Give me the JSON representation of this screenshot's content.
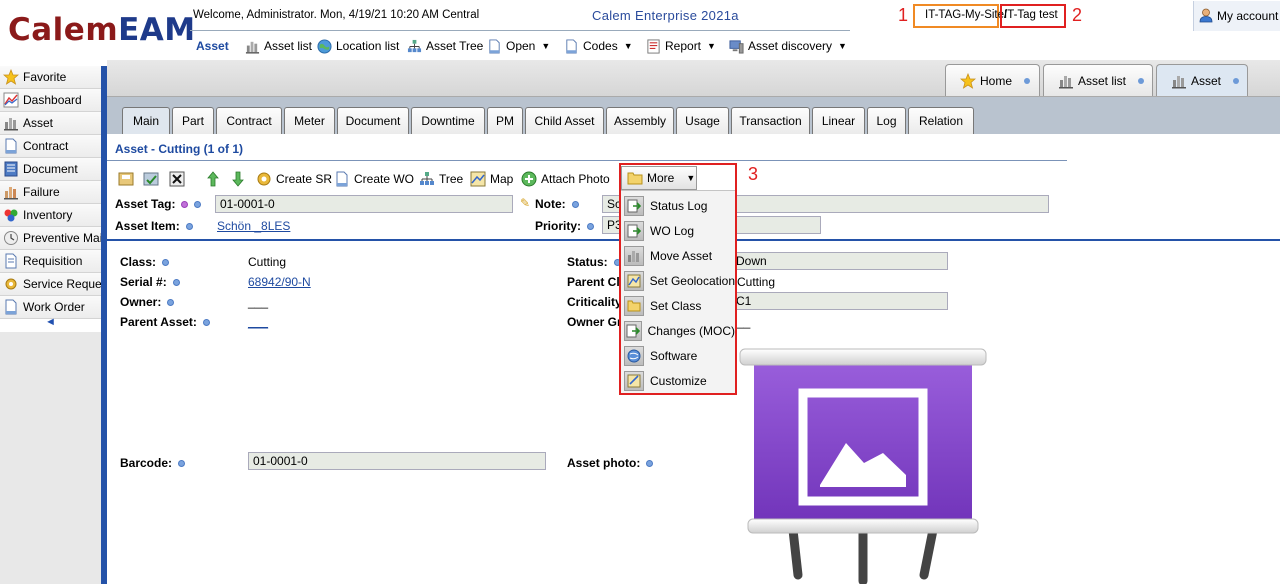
{
  "header": {
    "logo_left": "Calem",
    "logo_right": "EAM",
    "welcome": "Welcome, Administrator. Mon, 4/19/21 10:20 AM Central",
    "product": "Calem Enterprise 2021a",
    "site": "IT-TAG-My-Site/",
    "tag": "IT-Tag test",
    "my_account": "My account"
  },
  "annotations": {
    "n1": "1",
    "n2": "2",
    "n3": "3",
    "color": "#e02020"
  },
  "toolbar": {
    "asset": "Asset",
    "asset_list": "Asset list",
    "location_list": "Location list",
    "asset_tree": "Asset Tree",
    "open": "Open",
    "codes": "Codes",
    "report": "Report",
    "asset_discovery": "Asset discovery"
  },
  "sidebar": {
    "items": [
      {
        "label": "Favorite",
        "icon": "star-icon"
      },
      {
        "label": "Dashboard",
        "icon": "chart-icon"
      },
      {
        "label": "Asset",
        "icon": "asset-icon"
      },
      {
        "label": "Contract",
        "icon": "document-icon"
      },
      {
        "label": "Document",
        "icon": "document-icon"
      },
      {
        "label": "Failure",
        "icon": "failure-icon"
      },
      {
        "label": "Inventory",
        "icon": "inventory-icon"
      },
      {
        "label": "Preventive Maintenance",
        "icon": "clock-icon"
      },
      {
        "label": "Requisition",
        "icon": "requisition-icon"
      },
      {
        "label": "Service Request",
        "icon": "service-icon"
      },
      {
        "label": "Work Order",
        "icon": "document-icon"
      }
    ],
    "collapse": "◄"
  },
  "top_tabs": {
    "home": "Home",
    "asset_list": "Asset list",
    "asset": "Asset"
  },
  "sub_tabs": [
    "Main",
    "Part",
    "Contract",
    "Meter",
    "Document",
    "Downtime",
    "PM",
    "Child Asset",
    "Assembly",
    "Usage",
    "Transaction",
    "Linear",
    "Log",
    "Relation"
  ],
  "form": {
    "heading": "Asset - Cutting (1 of 1)",
    "actions": {
      "create_sr": "Create SR",
      "create_wo": "Create WO",
      "tree": "Tree",
      "map": "Map",
      "attach_photo": "Attach Photo",
      "more": "More"
    },
    "asset_tag_label": "Asset Tag:",
    "asset_tag": "01-0001-0",
    "note_label": "Note:",
    "note": "Sc",
    "asset_item_label": "Asset Item:",
    "asset_item": "Schön _8LES",
    "priority_label": "Priority:",
    "priority": "P3",
    "class_label": "Class:",
    "class": "Cutting",
    "serial_label": "Serial #:",
    "serial": "68942/90-N",
    "owner_label": "Owner:",
    "owner": "___",
    "parent_asset_label": "Parent Asset:",
    "parent_asset": "___",
    "status_label": "Status:",
    "status": "Down",
    "parent_class_label": "Parent Cl",
    "parent_class": "Cutting",
    "criticality_label": "Criticality",
    "criticality": "C1",
    "owner_group_label": "Owner Gr",
    "owner_group": "__",
    "barcode_label": "Barcode:",
    "barcode": "01-0001-0",
    "asset_photo_label": "Asset photo:"
  },
  "more_menu": [
    {
      "label": "Status Log",
      "icon": "status-log-icon"
    },
    {
      "label": "WO Log",
      "icon": "wo-log-icon"
    },
    {
      "label": "Move Asset",
      "icon": "move-asset-icon"
    },
    {
      "label": "Set Geolocation",
      "icon": "geolocation-icon"
    },
    {
      "label": "Set Class",
      "icon": "folder-icon"
    },
    {
      "label": "Changes (MOC)",
      "icon": "changes-icon"
    },
    {
      "label": "Software",
      "icon": "software-icon"
    },
    {
      "label": "Customize",
      "icon": "customize-icon"
    }
  ],
  "colors": {
    "accent": "#2452a8",
    "logo_red": "#8b1a1a",
    "logo_blue": "#1e3a8a",
    "link": "#1e4aa0",
    "photo_purple": "#7b3fc4"
  }
}
